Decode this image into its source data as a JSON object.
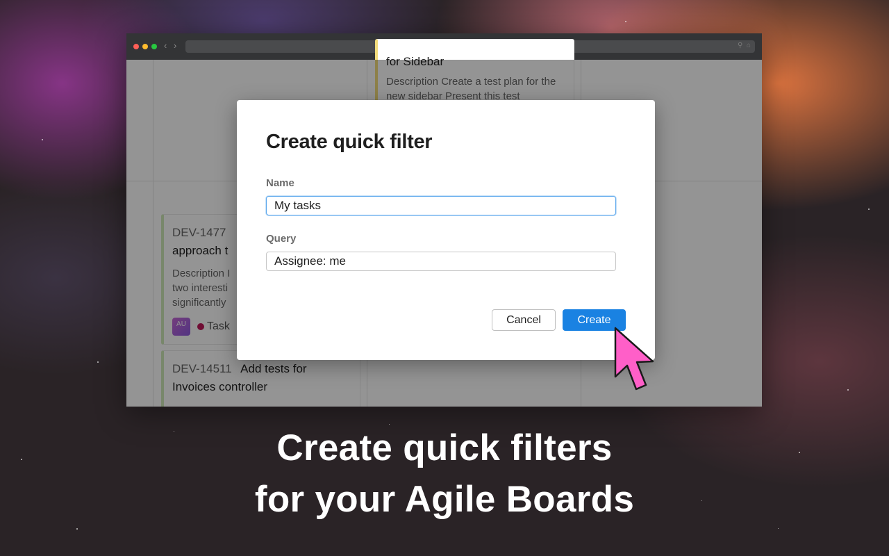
{
  "background": {
    "colors": {
      "orange": "#e27640",
      "purple": "#963796",
      "dark": "#2a2326"
    }
  },
  "browser": {
    "traffic_lights": {
      "red": "#fe5f57",
      "yellow": "#febc2e",
      "green": "#28c840"
    },
    "nav_back_icon": "chevron-left-icon",
    "nav_forward_icon": "chevron-right-icon"
  },
  "board": {
    "top_card": {
      "title_fragment": "for Sidebar",
      "description": "Description Create a test plan for the new sidebar Present this test"
    },
    "card_a": {
      "id": "DEV-1477а",
      "id_visible": "DEV-1477",
      "title": "approach t",
      "description_lines": [
        "Description I",
        "two interesti",
        "significantly"
      ],
      "avatar": "AU",
      "type": "Task"
    },
    "card_b": {
      "id": "DEV-14511",
      "title_line1": "Add tests for",
      "title_line2": "Invoices controller"
    }
  },
  "dialog": {
    "title": "Create quick filter",
    "name_label": "Name",
    "name_value": "My tasks",
    "query_label": "Query",
    "query_value": "Assignee: me",
    "cancel_label": "Cancel",
    "create_label": "Create",
    "create_color": "#1a82e2"
  },
  "cursor": {
    "color": "#ff5fc8"
  },
  "caption": {
    "line1": "Create quick filters",
    "line2": "for your Agile Boards"
  }
}
